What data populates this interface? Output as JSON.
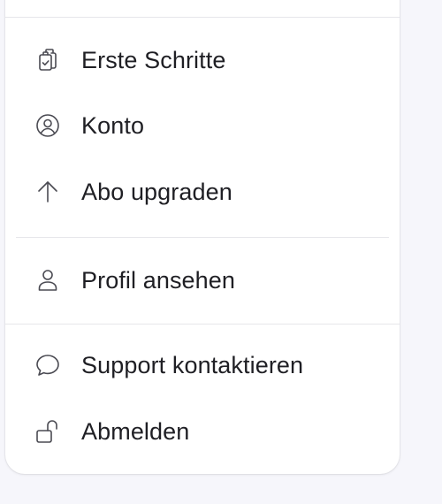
{
  "menu": {
    "items": [
      {
        "label": "Erste Schritte",
        "icon": "clipboard-check-icon"
      },
      {
        "label": "Konto",
        "icon": "user-circle-icon"
      },
      {
        "label": "Abo upgraden",
        "icon": "arrow-up-icon"
      },
      {
        "label": "Profil ansehen",
        "icon": "user-icon"
      },
      {
        "label": "Support kontaktieren",
        "icon": "chat-bubble-icon"
      },
      {
        "label": "Abmelden",
        "icon": "unlock-icon"
      }
    ]
  }
}
